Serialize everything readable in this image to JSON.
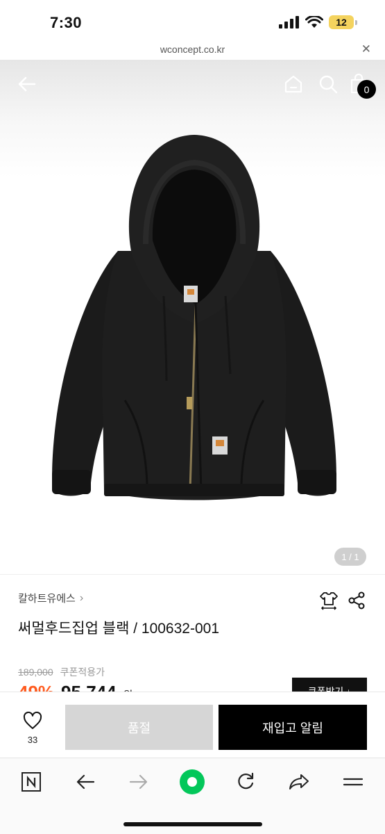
{
  "status_bar": {
    "time": "7:30",
    "battery": "12"
  },
  "browser": {
    "url": "wconcept.co.kr"
  },
  "hero": {
    "cart_count": "0",
    "image_counter": "1 / 1"
  },
  "product": {
    "brand": "칼하트유에스",
    "name": "써멀후드집업 블랙 / 100632-001",
    "original_price": "189,000",
    "coupon_label": "쿠폰적용가",
    "discount": "49%",
    "sale_price": "95,744",
    "currency": "원",
    "coupon_button": "쿠폰받기"
  },
  "purchase": {
    "wish_count": "33",
    "soldout_label": "품절",
    "restock_label": "재입고 알림"
  },
  "icons": {
    "back": "arrow-left-icon",
    "home": "home-icon",
    "search": "search-icon",
    "bag": "shopping-bag-icon",
    "size": "size-guide-icon",
    "share": "share-icon",
    "heart": "heart-icon"
  },
  "colors": {
    "discount": "#ff5b1f",
    "primary_button": "#000000",
    "soldout_button": "#d6d6d6",
    "battery": "#f4d35e",
    "browser_accent": "#03c75a"
  }
}
